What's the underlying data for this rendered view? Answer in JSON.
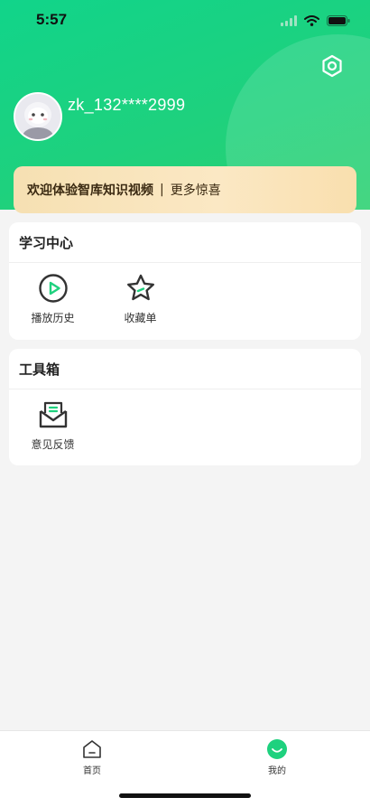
{
  "status_bar": {
    "time": "5:57"
  },
  "profile": {
    "username": "zk_132****2999"
  },
  "banner": {
    "text": "欢迎体验智库知识视频",
    "separator": "|",
    "more": "更多惊喜"
  },
  "learning_center": {
    "title": "学习中心",
    "items": [
      {
        "label": "播放历史",
        "icon": "play-circle-icon"
      },
      {
        "label": "收藏单",
        "icon": "star-icon"
      }
    ]
  },
  "toolbox": {
    "title": "工具箱",
    "items": [
      {
        "label": "意见反馈",
        "icon": "feedback-mail-icon"
      }
    ]
  },
  "tabbar": {
    "tabs": [
      {
        "label": "首页",
        "icon": "home-icon",
        "active": false
      },
      {
        "label": "我的",
        "icon": "profile-smile-icon",
        "active": true
      }
    ]
  },
  "colors": {
    "brand_green": "#1ed17e",
    "banner_gold": "#f6e0b2",
    "icon_stroke": "#333333"
  }
}
